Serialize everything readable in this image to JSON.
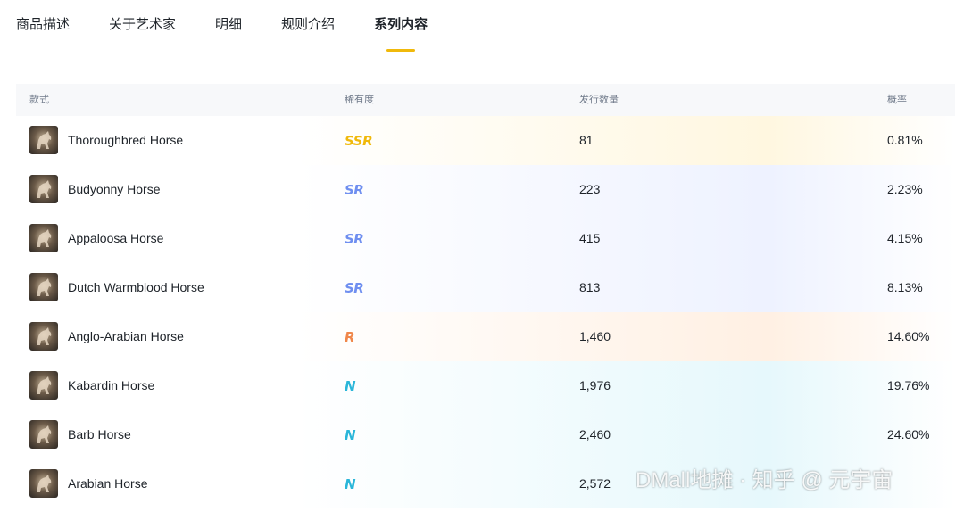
{
  "tabs": [
    {
      "label": "商品描述",
      "active": false
    },
    {
      "label": "关于艺术家",
      "active": false
    },
    {
      "label": "明细",
      "active": false
    },
    {
      "label": "规则介绍",
      "active": false
    },
    {
      "label": "系列内容",
      "active": true
    }
  ],
  "table": {
    "headers": {
      "style": "款式",
      "rarity": "稀有度",
      "supply": "发行数量",
      "probability": "概率"
    },
    "rows": [
      {
        "name": "Thoroughbred Horse",
        "rarity": "SSR",
        "rarity_color": "#f0b90b",
        "supply": "81",
        "probability": "0.81%",
        "bg": "#fff7e0"
      },
      {
        "name": "Budyonny Horse",
        "rarity": "SR",
        "rarity_color": "#6f8ff0",
        "supply": "223",
        "probability": "2.23%",
        "bg": "#eef2ff"
      },
      {
        "name": "Appaloosa Horse",
        "rarity": "SR",
        "rarity_color": "#6f8ff0",
        "supply": "415",
        "probability": "4.15%",
        "bg": "#eef2ff"
      },
      {
        "name": "Dutch Warmblood Horse",
        "rarity": "SR",
        "rarity_color": "#6f8ff0",
        "supply": "813",
        "probability": "8.13%",
        "bg": "#eef2ff"
      },
      {
        "name": "Anglo-Arabian Horse",
        "rarity": "R",
        "rarity_color": "#f0874a",
        "supply": "1,460",
        "probability": "14.60%",
        "bg": "#fff0e3"
      },
      {
        "name": "Kabardin Horse",
        "rarity": "N",
        "rarity_color": "#2ab6d9",
        "supply": "1,976",
        "probability": "19.76%",
        "bg": "#e6f8fc"
      },
      {
        "name": "Barb Horse",
        "rarity": "N",
        "rarity_color": "#2ab6d9",
        "supply": "2,460",
        "probability": "24.60%",
        "bg": "#e6f8fc"
      },
      {
        "name": "Arabian Horse",
        "rarity": "N",
        "rarity_color": "#2ab6d9",
        "supply": "2,572",
        "probability": "",
        "bg": "#e6f8fc"
      }
    ]
  },
  "watermark": "DMall地摊 · 知乎 @ 元宇宙"
}
